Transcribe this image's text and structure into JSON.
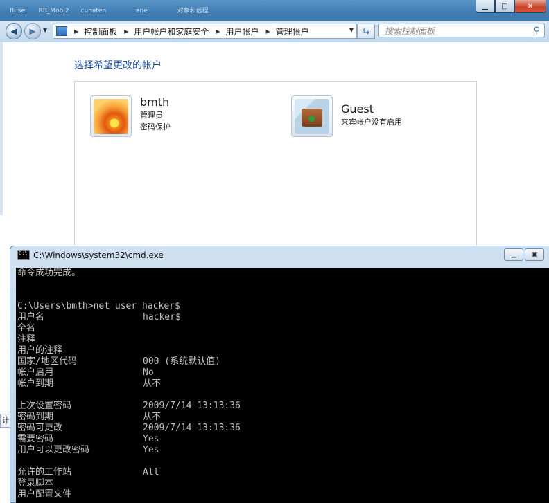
{
  "titlebar": {
    "ghost_tabs": [
      "Busel",
      "RB_Mobi2",
      "cunaten",
      "ane",
      "对象和远程"
    ]
  },
  "nav": {
    "back_icon": "back-arrow-icon",
    "forward_icon": "forward-arrow-icon"
  },
  "address": {
    "crumbs": [
      "控制面板",
      "用户帐户和家庭安全",
      "用户帐户",
      "管理帐户"
    ]
  },
  "search": {
    "placeholder": "搜索控制面板"
  },
  "page": {
    "heading": "选择希望更改的帐户"
  },
  "accounts": [
    {
      "name": "bmth",
      "line1": "管理员",
      "line2": "密码保护",
      "picture": "orange-flower"
    },
    {
      "name": "Guest",
      "line1": "来宾帐户没有启用",
      "line2": "",
      "picture": "suitcase"
    }
  ],
  "left_edge": {
    "button_label": "计"
  },
  "cmd": {
    "title": "C:\\Windows\\system32\\cmd.exe",
    "lines": [
      {
        "label": "命令成功完成。",
        "value": ""
      },
      {
        "label": "",
        "value": ""
      },
      {
        "label": "",
        "value": ""
      },
      {
        "label": "C:\\Users\\bmth>net user hacker$",
        "value": ""
      },
      {
        "label": "用户名",
        "value": "hacker$"
      },
      {
        "label": "全名",
        "value": ""
      },
      {
        "label": "注释",
        "value": ""
      },
      {
        "label": "用户的注释",
        "value": ""
      },
      {
        "label": "国家/地区代码",
        "value": "000 (系统默认值)"
      },
      {
        "label": "帐户启用",
        "value": "No"
      },
      {
        "label": "帐户到期",
        "value": "从不"
      },
      {
        "label": "",
        "value": ""
      },
      {
        "label": "上次设置密码",
        "value": "2009/7/14 13:13:36"
      },
      {
        "label": "密码到期",
        "value": "从不"
      },
      {
        "label": "密码可更改",
        "value": "2009/7/14 13:13:36"
      },
      {
        "label": "需要密码",
        "value": "Yes"
      },
      {
        "label": "用户可以更改密码",
        "value": "Yes"
      },
      {
        "label": "",
        "value": ""
      },
      {
        "label": "允许的工作站",
        "value": "All"
      },
      {
        "label": "登录脚本",
        "value": ""
      },
      {
        "label": "用户配置文件",
        "value": ""
      }
    ]
  }
}
